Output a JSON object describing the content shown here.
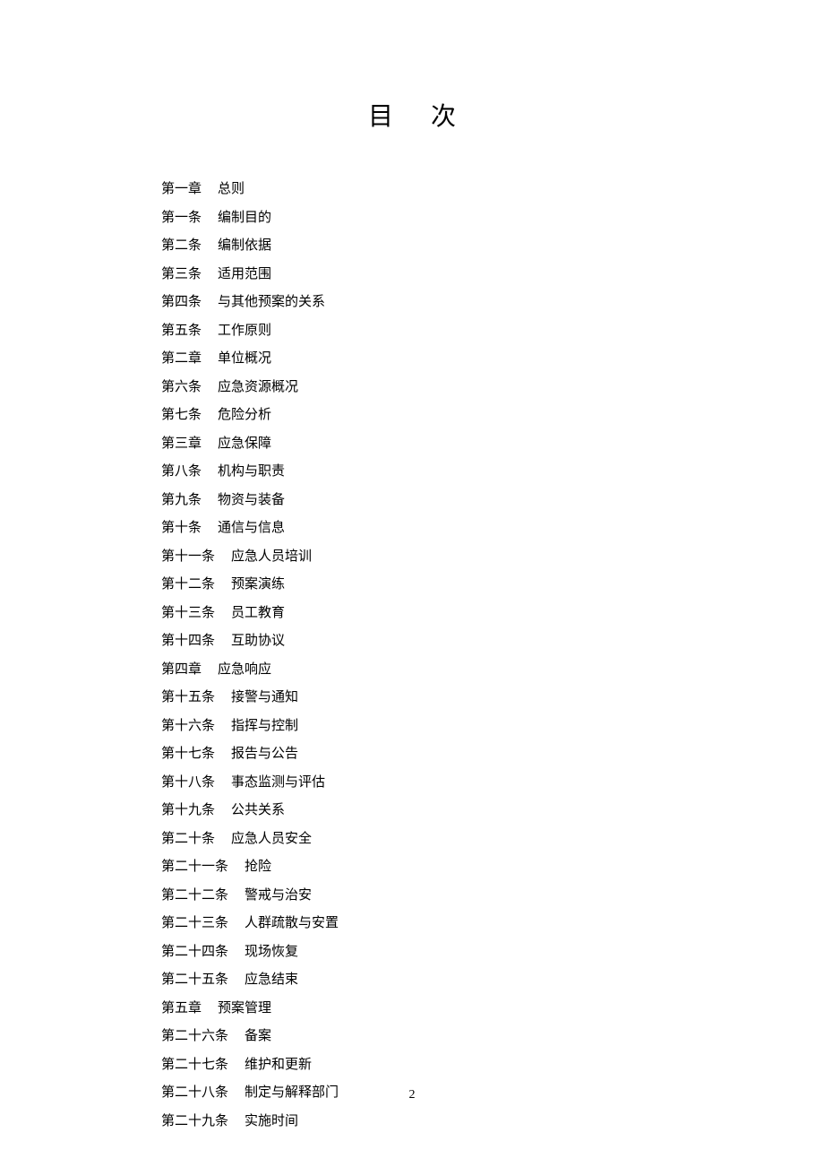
{
  "title": "目次",
  "entries": [
    {
      "label": "第一章",
      "text": "总则"
    },
    {
      "label": "第一条",
      "text": "编制目的"
    },
    {
      "label": "第二条",
      "text": "编制依据"
    },
    {
      "label": "第三条",
      "text": "适用范围"
    },
    {
      "label": "第四条",
      "text": "与其他预案的关系"
    },
    {
      "label": "第五条",
      "text": "工作原则"
    },
    {
      "label": "第二章",
      "text": "单位概况"
    },
    {
      "label": "第六条",
      "text": "应急资源概况"
    },
    {
      "label": "第七条",
      "text": "危险分析"
    },
    {
      "label": "第三章",
      "text": "应急保障"
    },
    {
      "label": "第八条",
      "text": "机构与职责"
    },
    {
      "label": "第九条",
      "text": "物资与装备"
    },
    {
      "label": "第十条",
      "text": "通信与信息"
    },
    {
      "label": "第十一条",
      "text": "应急人员培训"
    },
    {
      "label": "第十二条",
      "text": "预案演练"
    },
    {
      "label": "第十三条",
      "text": "员工教育"
    },
    {
      "label": "第十四条",
      "text": "互助协议"
    },
    {
      "label": "第四章",
      "text": "应急响应"
    },
    {
      "label": "第十五条",
      "text": "接警与通知"
    },
    {
      "label": "第十六条",
      "text": "指挥与控制"
    },
    {
      "label": "第十七条",
      "text": "报告与公告"
    },
    {
      "label": "第十八条",
      "text": "事态监测与评估"
    },
    {
      "label": "第十九条",
      "text": "公共关系"
    },
    {
      "label": "第二十条",
      "text": "应急人员安全"
    },
    {
      "label": "第二十一条",
      "text": "抢险"
    },
    {
      "label": "第二十二条",
      "text": "警戒与治安"
    },
    {
      "label": "第二十三条",
      "text": "人群疏散与安置"
    },
    {
      "label": "第二十四条",
      "text": "现场恢复"
    },
    {
      "label": "第二十五条",
      "text": "应急结束"
    },
    {
      "label": "第五章",
      "text": "预案管理"
    },
    {
      "label": "第二十六条",
      "text": "备案"
    },
    {
      "label": "第二十七条",
      "text": "维护和更新"
    },
    {
      "label": "第二十八条",
      "text": "制定与解释部门"
    },
    {
      "label": "第二十九条",
      "text": "实施时间"
    }
  ],
  "page_number": "2"
}
